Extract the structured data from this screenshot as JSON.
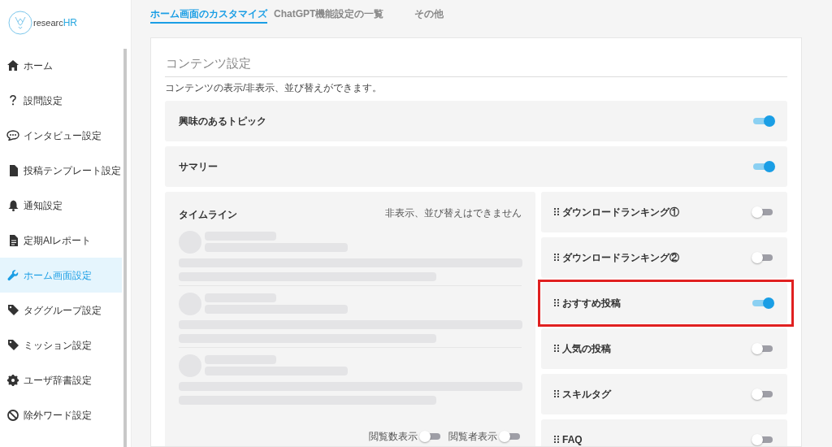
{
  "logo": {
    "text_1": "researc",
    "text_2": "HR"
  },
  "sidebar": {
    "items": [
      {
        "label": "ホーム",
        "selected": false
      },
      {
        "label": "設問設定",
        "selected": false
      },
      {
        "label": "インタビュー設定",
        "selected": false
      },
      {
        "label": "投稿テンプレート設定",
        "selected": false
      },
      {
        "label": "通知設定",
        "selected": false
      },
      {
        "label": "定期AIレポート",
        "selected": false
      },
      {
        "label": "ホーム画面設定",
        "selected": true
      },
      {
        "label": "タググループ設定",
        "selected": false
      },
      {
        "label": "ミッション設定",
        "selected": false
      },
      {
        "label": "ユーザ辞書設定",
        "selected": false
      },
      {
        "label": "除外ワード設定",
        "selected": false
      }
    ]
  },
  "tabs": [
    {
      "label": "ホーム画面のカスタマイズ",
      "selected": true
    },
    {
      "label": "ChatGPT機能設定の一覧",
      "selected": false
    },
    {
      "label": "その他",
      "selected": false
    }
  ],
  "section": {
    "title": "コンテンツ設定",
    "description": "コンテンツの表示/非表示、並び替えができます。",
    "fixed_rows": [
      {
        "label": "興味のあるトピック",
        "on": true
      },
      {
        "label": "サマリー",
        "on": true
      }
    ],
    "timeline": {
      "title": "タイムライン",
      "note": "非表示、並び替えはできません",
      "toggles": [
        {
          "label": "閲覧数表示",
          "on": false
        },
        {
          "label": "閲覧者表示",
          "on": false
        }
      ]
    },
    "sortable_rows": [
      {
        "label": "ダウンロードランキング①",
        "on": false,
        "highlighted": false
      },
      {
        "label": "ダウンロードランキング②",
        "on": false,
        "highlighted": false
      },
      {
        "label": "おすすめ投稿",
        "on": true,
        "highlighted": true
      },
      {
        "label": "人気の投稿",
        "on": false,
        "highlighted": false
      },
      {
        "label": "スキルタグ",
        "on": false,
        "highlighted": false
      },
      {
        "label": "FAQ",
        "on": false,
        "highlighted": false
      }
    ]
  }
}
